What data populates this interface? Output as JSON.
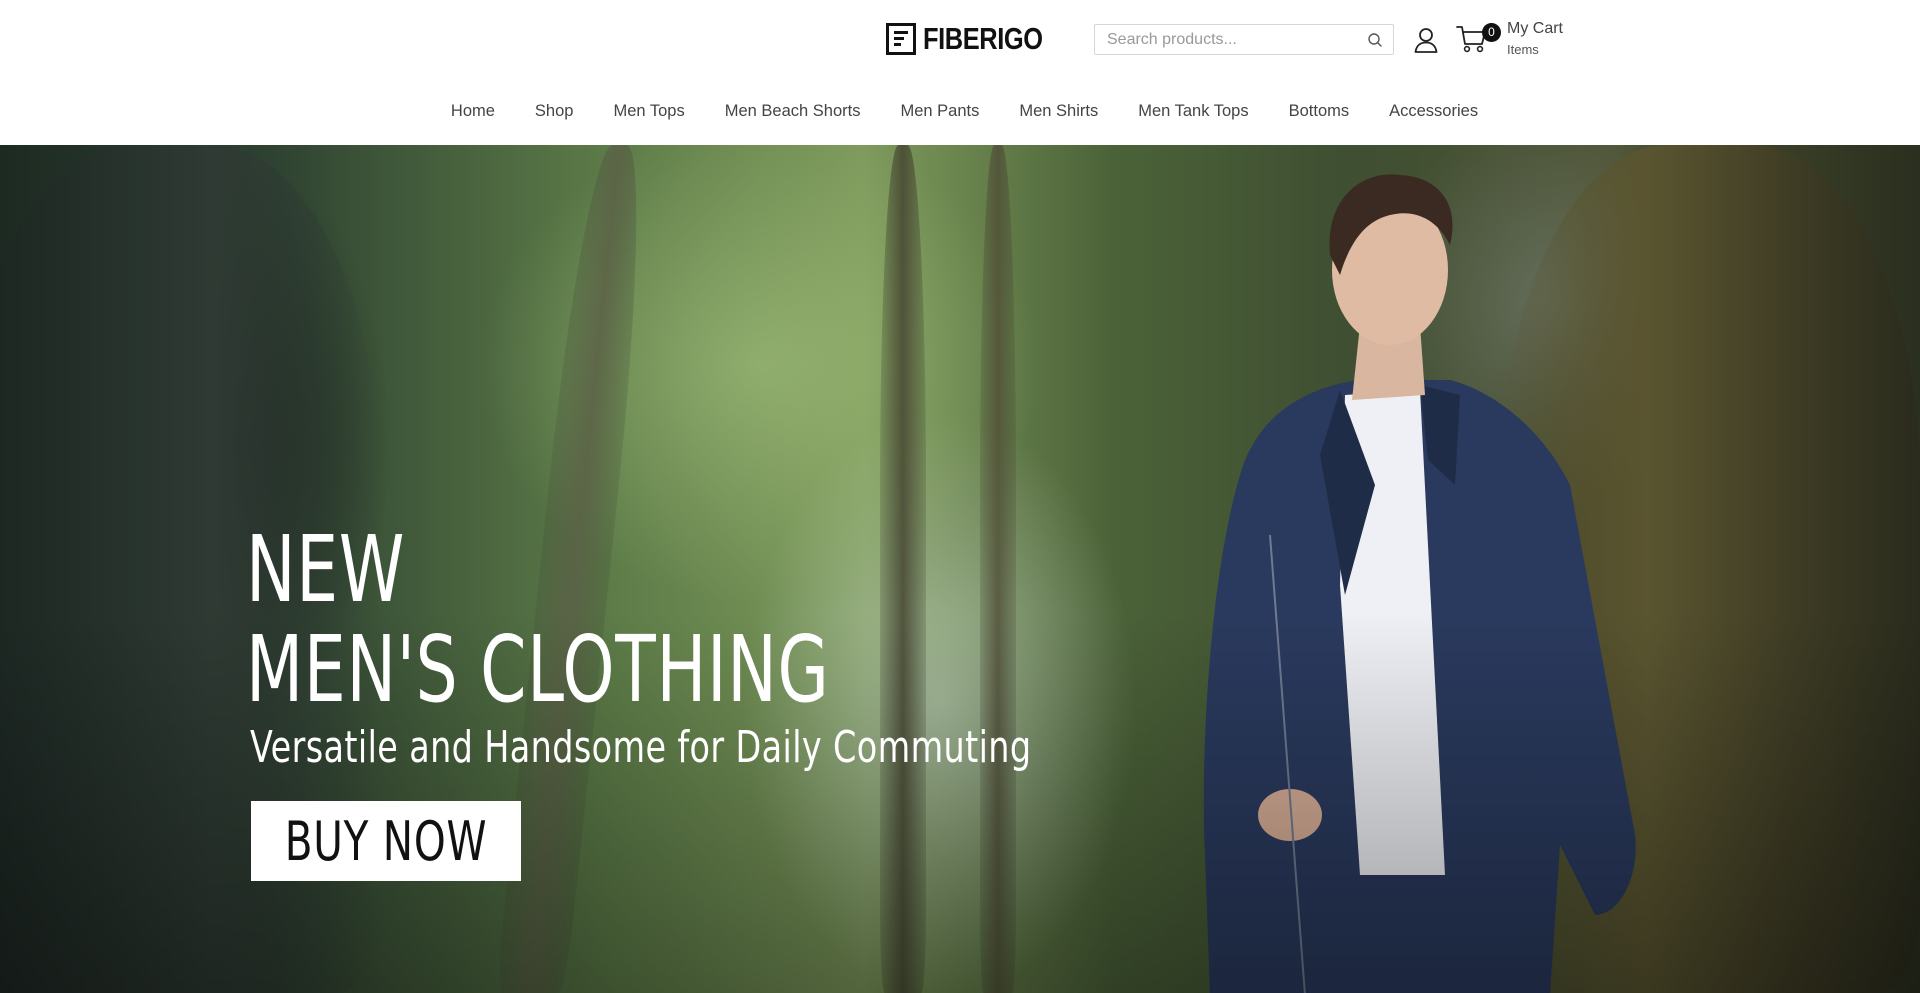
{
  "brand": {
    "name": "FIBERIGO"
  },
  "search": {
    "placeholder": "Search products..."
  },
  "cart": {
    "count": "0",
    "title": "My Cart",
    "subtitle": "Items"
  },
  "nav": {
    "items": [
      {
        "label": "Home"
      },
      {
        "label": "Shop"
      },
      {
        "label": "Men Tops"
      },
      {
        "label": "Men Beach Shorts"
      },
      {
        "label": "Men Pants"
      },
      {
        "label": "Men Shirts"
      },
      {
        "label": "Men Tank Tops"
      },
      {
        "label": "Bottoms"
      },
      {
        "label": "Accessories"
      }
    ]
  },
  "hero": {
    "headline_line1": "NEW",
    "headline_line2": "MEN'S CLOTHING",
    "subheadline": "Versatile and Handsome for Daily Commuting",
    "cta_label": "BUY NOW"
  },
  "icons": {
    "search": "search-icon",
    "user": "user-icon",
    "cart": "cart-icon"
  },
  "colors": {
    "accent": "#111111",
    "nav_text": "#444444",
    "hero_text": "#ffffff",
    "cta_background": "#ffffff"
  }
}
